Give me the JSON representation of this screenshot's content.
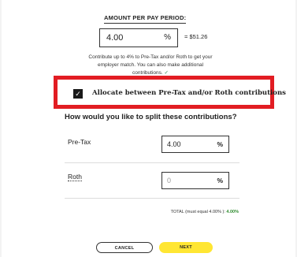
{
  "amount": {
    "label": "AMOUNT PER PAY PERIOD:",
    "value": "4.00",
    "unit": "%",
    "equivalent": "= $51.26"
  },
  "note": {
    "line1": "Contribute up to 4% to Pre-Tax and/or Roth to get your",
    "line2": "employer match. You can also make additional",
    "line3": "contributions.",
    "check": "✓"
  },
  "allocate": {
    "checked": true,
    "checkmark": "✓",
    "label": "Allocate between Pre-Tax and/or Roth contributions"
  },
  "split": {
    "question": "How would you like to split these contributions?",
    "rows": [
      {
        "label": "Pre-Tax",
        "value": "4.00",
        "unit": "%"
      },
      {
        "label": "Roth",
        "value": "0",
        "unit": "%"
      }
    ],
    "total_label": "TOTAL (must equal 4.00% ):",
    "total_value": "4.00%"
  },
  "buttons": {
    "cancel": "CANCEL",
    "next": "NEXT"
  },
  "colors": {
    "highlight_border": "#e21d23",
    "next_button": "#ffe633",
    "success_green": "#2e8b2e"
  }
}
